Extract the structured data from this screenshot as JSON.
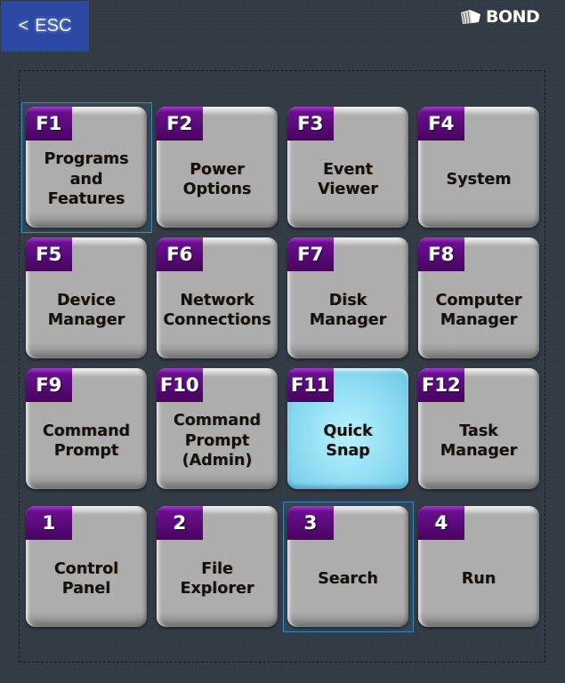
{
  "header": {
    "back_button": {
      "chevron": "<",
      "label": "ESC"
    },
    "logo": {
      "icon": "bond-logo-mark-icon",
      "text": "BOND"
    }
  },
  "grid": {
    "focused_tiles": [
      "F1",
      "3"
    ],
    "active_tile": "F11",
    "colors": {
      "badge": "#47045e",
      "tile": "#adadad",
      "active_tile": "#8fdcf2",
      "focus_border": "#3b87b8",
      "esc_button": "#2b48a3",
      "background": "#333b46"
    },
    "tiles": [
      {
        "key": "F1",
        "label": "Programs\nand\nFeatures"
      },
      {
        "key": "F2",
        "label": "Power\nOptions"
      },
      {
        "key": "F3",
        "label": "Event\nViewer"
      },
      {
        "key": "F4",
        "label": "System"
      },
      {
        "key": "F5",
        "label": "Device\nManager"
      },
      {
        "key": "F6",
        "label": "Network\nConnections"
      },
      {
        "key": "F7",
        "label": "Disk\nManager"
      },
      {
        "key": "F8",
        "label": "Computer\nManager"
      },
      {
        "key": "F9",
        "label": "Command\nPrompt"
      },
      {
        "key": "F10",
        "label": "Command\nPrompt\n(Admin)"
      },
      {
        "key": "F11",
        "label": "Quick\nSnap"
      },
      {
        "key": "F12",
        "label": "Task\nManager"
      },
      {
        "key": "1",
        "label": "Control\nPanel"
      },
      {
        "key": "2",
        "label": "File\nExplorer"
      },
      {
        "key": "3",
        "label": "Search"
      },
      {
        "key": "4",
        "label": "Run"
      }
    ]
  }
}
